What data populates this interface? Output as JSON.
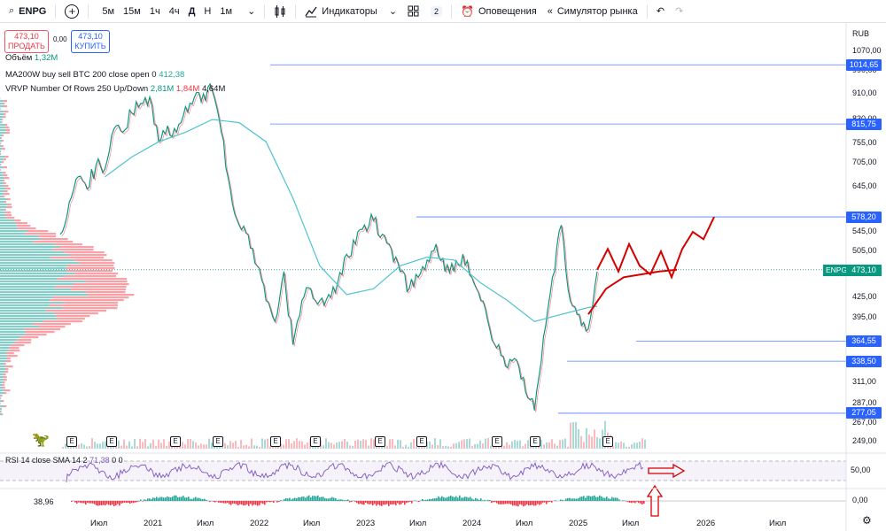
{
  "toolbar": {
    "symbol": "ENPG",
    "timeframes": [
      "5м",
      "15м",
      "1ч",
      "4ч",
      "Д",
      "Н",
      "1м"
    ],
    "active_timeframe": "Д",
    "indicators_label": "Индикаторы",
    "layouts_count": "2",
    "alerts_label": "Оповещения",
    "replay_label": "Симулятор рынка"
  },
  "trade": {
    "sell_price": "473,10",
    "sell_label": "ПРОДАТЬ",
    "spread": "0,00",
    "buy_price": "473,10",
    "buy_label": "КУПИТЬ"
  },
  "legend": {
    "volume_label": "Объём",
    "volume_value": "1,32M",
    "ma_label": "MA200W buy sell BTC 200 close open 0",
    "ma_value": "412,38",
    "vrvp_label": "VRVP Number Of Rows 250 Up/Down",
    "vrvp_up": "2,81M",
    "vrvp_down": "1,84M",
    "vrvp_total": "4,64M"
  },
  "rsi": {
    "label": "RSI 14 close SMA 14 2",
    "value": "71,38",
    "extra": "0 0",
    "axis_value": "50,00"
  },
  "osc": {
    "value": "38,96",
    "axis_value": "0,00"
  },
  "chart_data": {
    "type": "line",
    "currency": "RUB",
    "y_ticks": [
      "1070,00",
      "990,00",
      "910,00",
      "830,00",
      "755,00",
      "705,00",
      "645,00",
      "545,00",
      "505,00",
      "425,00",
      "395,00",
      "311,00",
      "287,00",
      "267,00",
      "249,00"
    ],
    "x_tick_labels": [
      "Июл",
      "2021",
      "Июл",
      "2022",
      "Июл",
      "2023",
      "Июл",
      "2024",
      "Июл",
      "2025",
      "Июл",
      "2026",
      "Июл"
    ],
    "price_levels": [
      "1014,65",
      "815,75",
      "578,20",
      "364,55",
      "338,50",
      "277,05"
    ],
    "last_price": "473,10",
    "last_symbol": "ENPG",
    "series": [
      {
        "name": "ENPG",
        "x": [
          "2020-07",
          "2020-08",
          "2020-09",
          "2020-10",
          "2020-11",
          "2020-12",
          "2021-01",
          "2021-02",
          "2021-03",
          "2021-04",
          "2021-05",
          "2021-06",
          "2021-07",
          "2021-08",
          "2021-09",
          "2021-10",
          "2021-11",
          "2021-12",
          "2022-01",
          "2022-02",
          "2022-03",
          "2022-04",
          "2022-05",
          "2022-06",
          "2022-07",
          "2022-08",
          "2022-09",
          "2022-10",
          "2022-11",
          "2022-12",
          "2023-01",
          "2023-02",
          "2023-03",
          "2023-04",
          "2023-05",
          "2023-06",
          "2023-07",
          "2023-08",
          "2023-09",
          "2023-10",
          "2023-11",
          "2023-12",
          "2024-01",
          "2024-02",
          "2024-03",
          "2024-04",
          "2024-05",
          "2024-06",
          "2024-07",
          "2024-08",
          "2024-09",
          "2024-10",
          "2024-11",
          "2024-12",
          "2025-01",
          "2025-02",
          "2025-03",
          "2025-04",
          "2025-05",
          "2025-06",
          "2025-07"
        ],
        "values": [
          540,
          610,
          670,
          640,
          700,
          690,
          800,
          790,
          850,
          880,
          900,
          760,
          810,
          790,
          870,
          900,
          910,
          920,
          790,
          640,
          560,
          540,
          480,
          420,
          390,
          470,
          360,
          420,
          440,
          420,
          430,
          450,
          500,
          520,
          560,
          570,
          540,
          510,
          470,
          440,
          460,
          490,
          520,
          470,
          470,
          500,
          460,
          420,
          380,
          360,
          330,
          340,
          300,
          280,
          370,
          460,
          560,
          420,
          400,
          380,
          470
        ]
      },
      {
        "name": "MA200W buy sell BTC 200 close open 0",
        "x": [
          "2020-12",
          "2021-03",
          "2021-06",
          "2021-09",
          "2021-12",
          "2022-03",
          "2022-06",
          "2022-09",
          "2022-12",
          "2023-03",
          "2023-06",
          "2023-09",
          "2023-12",
          "2024-03",
          "2024-06",
          "2024-09",
          "2024-12",
          "2025-03",
          "2025-06",
          "2025-07"
        ],
        "values": [
          670,
          720,
          760,
          790,
          830,
          820,
          760,
          620,
          480,
          430,
          440,
          480,
          495,
          490,
          450,
          420,
          390,
          400,
          410,
          412
        ]
      }
    ],
    "projection_wave": [
      473,
      510,
      470,
      520,
      480,
      465,
      505,
      460,
      510,
      545,
      530,
      578
    ],
    "projection_trend": [
      400,
      440,
      460,
      465,
      470,
      473
    ]
  }
}
